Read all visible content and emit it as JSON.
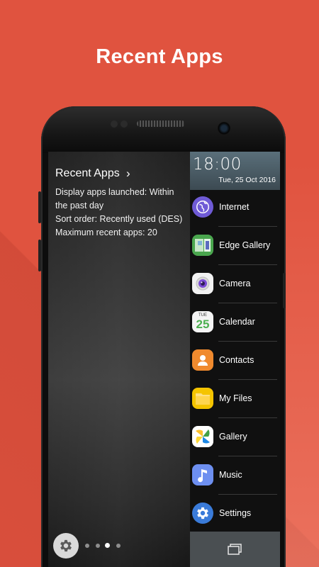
{
  "hero": {
    "title": "Recent Apps"
  },
  "panel": {
    "title": "Recent Apps",
    "chevron": "›",
    "lines": [
      "Display apps launched: Within",
      "the past day",
      "Sort order: Recently used (DES)",
      "Maximum recent apps: 20"
    ],
    "page_count": 4,
    "active_page": 3
  },
  "edge": {
    "time": "18:00",
    "date": "Tue, 25 Oct 2016",
    "apps": [
      {
        "label": "Internet",
        "icon": "internet-icon",
        "color": "#6f5bd6"
      },
      {
        "label": "Edge Gallery",
        "icon": "edge-gallery-icon",
        "color": "#4aa64e"
      },
      {
        "label": "Camera",
        "icon": "camera-icon",
        "color": "#f2f2f2"
      },
      {
        "label": "Calendar",
        "icon": "calendar-icon",
        "color": "#f4f4f4",
        "day": "25",
        "weekday": "TUE"
      },
      {
        "label": "Contacts",
        "icon": "contacts-icon",
        "color": "#f08a2e"
      },
      {
        "label": "My Files",
        "icon": "my-files-icon",
        "color": "#f5c400"
      },
      {
        "label": "Gallery",
        "icon": "gallery-icon",
        "color": "#ffffff"
      },
      {
        "label": "Music",
        "icon": "music-icon",
        "color": "#6d8ff0"
      },
      {
        "label": "Settings",
        "icon": "settings-icon",
        "color": "#3a7bd9"
      }
    ]
  },
  "colors": {
    "background": "#e0533f",
    "edge_panel": "#101010",
    "clock_header": "#4d5f69"
  }
}
